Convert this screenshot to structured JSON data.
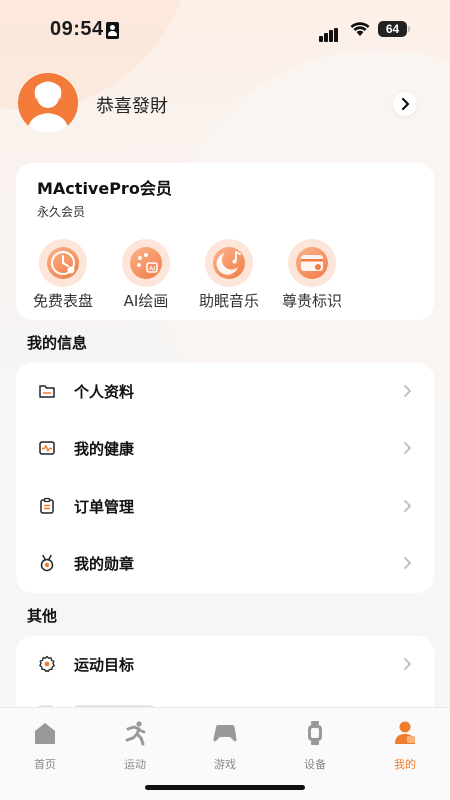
{
  "status_bar": {
    "time": "09:54",
    "battery": "64"
  },
  "profile": {
    "username": "恭喜發財"
  },
  "membership": {
    "title": "MActivePro会员",
    "subtitle": "永久会员",
    "perks": [
      {
        "label": "免费表盘",
        "icon": "watch-face-icon"
      },
      {
        "label": "AI绘画",
        "icon": "ai-palette-icon"
      },
      {
        "label": "助眠音乐",
        "icon": "sleep-music-icon"
      },
      {
        "label": "尊贵标识",
        "icon": "vip-badge-icon"
      }
    ]
  },
  "my_info": {
    "title": "我的信息",
    "items": [
      {
        "label": "个人资料",
        "icon": "folder-icon"
      },
      {
        "label": "我的健康",
        "icon": "heart-rate-icon"
      },
      {
        "label": "订单管理",
        "icon": "clipboard-icon"
      },
      {
        "label": "我的勋章",
        "icon": "medal-icon"
      }
    ]
  },
  "other": {
    "title": "其他",
    "items": [
      {
        "label": "运动目标",
        "icon": "gear-icon"
      }
    ]
  },
  "tab_bar": {
    "tabs": [
      {
        "label": "首页",
        "icon": "home-icon"
      },
      {
        "label": "运动",
        "icon": "running-icon"
      },
      {
        "label": "游戏",
        "icon": "gamepad-icon"
      },
      {
        "label": "设备",
        "icon": "watch-icon"
      },
      {
        "label": "我的",
        "icon": "profile-icon",
        "active": true
      }
    ]
  },
  "colors": {
    "accent": "#f07c2e",
    "avatar_bg": "#f47a3a"
  }
}
